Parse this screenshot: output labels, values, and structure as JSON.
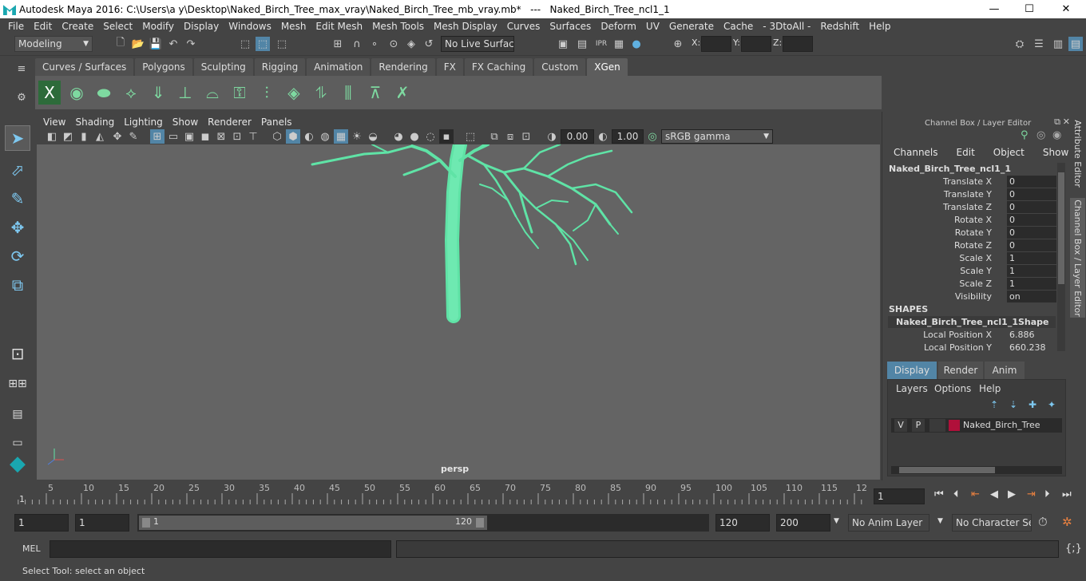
{
  "window": {
    "title": "Autodesk Maya 2016: C:\\Users\\a y\\Desktop\\Naked_Birch_Tree_max_vray\\Naked_Birch_Tree_mb_vray.mb*   ---   Naked_Birch_Tree_ncl1_1",
    "minimize": "—",
    "maximize": "☐",
    "close": "✕"
  },
  "menubar": [
    "File",
    "Edit",
    "Create",
    "Select",
    "Modify",
    "Display",
    "Windows",
    "Mesh",
    "Edit Mesh",
    "Mesh Tools",
    "Mesh Display",
    "Curves",
    "Surfaces",
    "Deform",
    "UV",
    "Generate",
    "Cache",
    "- 3DtoAll -",
    "Redshift",
    "Help"
  ],
  "status": {
    "mode": "Modeling",
    "live_surface": "No Live Surface",
    "x_label": "X:",
    "y_label": "Y:",
    "z_label": "Z:"
  },
  "shelf_tabs": [
    "Curves / Surfaces",
    "Polygons",
    "Sculpting",
    "Rigging",
    "Animation",
    "Rendering",
    "FX",
    "FX Caching",
    "Custom",
    "XGen"
  ],
  "shelf_active": "XGen",
  "viewport": {
    "menu": [
      "View",
      "Shading",
      "Lighting",
      "Show",
      "Renderer",
      "Panels"
    ],
    "exposure": "0.00",
    "gamma": "1.00",
    "color_space": "sRGB gamma",
    "camera": "persp"
  },
  "channel_box": {
    "title": "Channel Box / Layer Editor",
    "menu": [
      "Channels",
      "Edit",
      "Object",
      "Show"
    ],
    "object": "Naked_Birch_Tree_ncl1_1",
    "channels": [
      {
        "label": "Translate X",
        "value": "0"
      },
      {
        "label": "Translate Y",
        "value": "0"
      },
      {
        "label": "Translate Z",
        "value": "0"
      },
      {
        "label": "Rotate X",
        "value": "0"
      },
      {
        "label": "Rotate Y",
        "value": "0"
      },
      {
        "label": "Rotate Z",
        "value": "0"
      },
      {
        "label": "Scale X",
        "value": "1"
      },
      {
        "label": "Scale Y",
        "value": "1"
      },
      {
        "label": "Scale Z",
        "value": "1"
      },
      {
        "label": "Visibility",
        "value": "on"
      }
    ],
    "shapes_header": "SHAPES",
    "shape_name": "Naked_Birch_Tree_ncl1_1Shape",
    "shape_channels": [
      {
        "label": "Local Position X",
        "value": "6.886"
      },
      {
        "label": "Local Position Y",
        "value": "660.238"
      }
    ]
  },
  "layer_editor": {
    "tabs": [
      "Display",
      "Render",
      "Anim"
    ],
    "active_tab": "Display",
    "menu": [
      "Layers",
      "Options",
      "Help"
    ],
    "layer": {
      "v": "V",
      "p": "P",
      "name": "Naked_Birch_Tree",
      "color": "#b0103a"
    }
  },
  "side_tabs": [
    "Attribute Editor",
    "Channel Box / Layer Editor"
  ],
  "timeline": {
    "ticks": [
      "5",
      "10",
      "15",
      "20",
      "25",
      "30",
      "35",
      "40",
      "45",
      "50",
      "55",
      "60",
      "65",
      "70",
      "75",
      "80",
      "85",
      "90",
      "95",
      "100",
      "105",
      "110",
      "115",
      "12"
    ],
    "start_marker": "1",
    "current_frame": "1"
  },
  "range": {
    "start": "1",
    "playback_start": "1",
    "slider_start": "1",
    "slider_end": "120",
    "playback_end": "120",
    "end": "200",
    "anim_layer": "No Anim Layer",
    "character_set": "No Character Set"
  },
  "mel": {
    "label": "MEL"
  },
  "help_line": "Select Tool: select an object",
  "colors": {
    "mesh": "#5fe3a6",
    "bg": "#444444",
    "viewport": "#646464"
  }
}
